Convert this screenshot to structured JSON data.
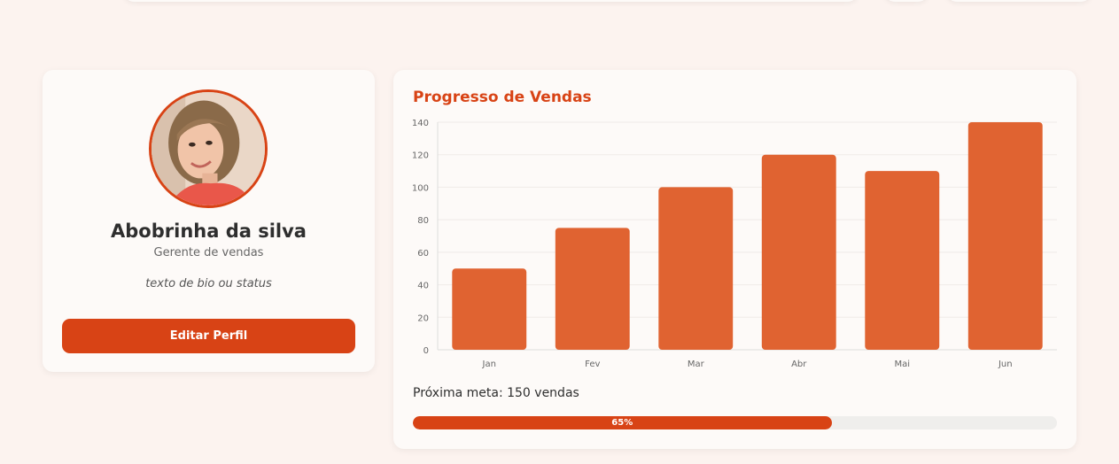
{
  "colors": {
    "background": "#fcf3ef",
    "accent": "#d84315",
    "bar": "#e06331",
    "card": "#fdfaf8"
  },
  "profile": {
    "name": "Abobrinha da silva",
    "role": "Gerente de vendas",
    "bio": "texto de bio ou status",
    "edit_label": "Editar Perfil",
    "avatar": "woman-portrait-photo"
  },
  "sales": {
    "title": "Progresso de Vendas",
    "next_goal": "Próxima meta: 150 vendas",
    "progress_label": "65%",
    "progress_value": 0.65
  },
  "chart_data": {
    "type": "bar",
    "title": "Progresso de Vendas",
    "categories": [
      "Jan",
      "Fev",
      "Mar",
      "Abr",
      "Mai",
      "Jun"
    ],
    "values": [
      50,
      75,
      100,
      120,
      110,
      140
    ],
    "ylim": [
      0,
      140
    ],
    "yticks": [
      0,
      20,
      40,
      60,
      80,
      100,
      120,
      140
    ],
    "grid": true,
    "xlabel": "",
    "ylabel": ""
  }
}
